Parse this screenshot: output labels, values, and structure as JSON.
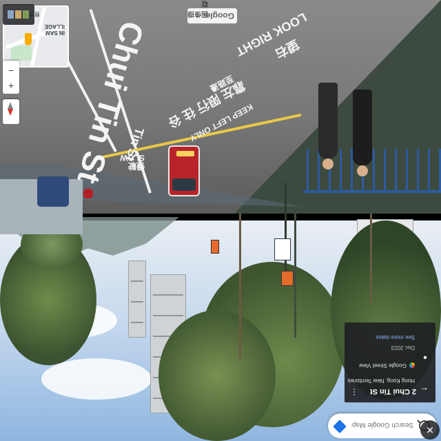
{
  "search": {
    "placeholder": "Search Google Maps"
  },
  "info_card": {
    "title": "2 Chui Tin St",
    "location": "Hong Kong, New Territories",
    "brand": "Google Street View",
    "date": "Dec 2023",
    "see_more_dates": "See more dates"
  },
  "minimap": {
    "label_line1": "IN SAM",
    "label_line2": "ILLAGE",
    "label_place": "曾大屋"
  },
  "footer_chip": {
    "google": "Google",
    "street_view_label": "圖像擷取"
  },
  "road_markings": {
    "street_name": "Chui Tin St",
    "street_short": "Tin St",
    "slow_en": "SLOW",
    "slow_zh": "慢駛",
    "look_right_en": "LOOK RIGHT",
    "look_right_zh": "望右",
    "keep_left_en": "KEEP LEFT ONLY",
    "keep_left_zh": "靠左 限行 往 谷",
    "extra_zh": "至路邊"
  },
  "colors": {
    "accent": "#1a73e8",
    "card_bg": "#202124",
    "bus_red": "#b8242a",
    "fence_blue": "#2a5fb3"
  },
  "icons": {
    "search": "search-icon",
    "directions": "directions-icon",
    "back": "arrow-back-icon",
    "more": "more-vert-icon",
    "compass": "compass-icon",
    "zoom_in": "plus-icon",
    "zoom_out": "minus-icon",
    "close": "close-icon",
    "pegman": "pegman-icon"
  }
}
